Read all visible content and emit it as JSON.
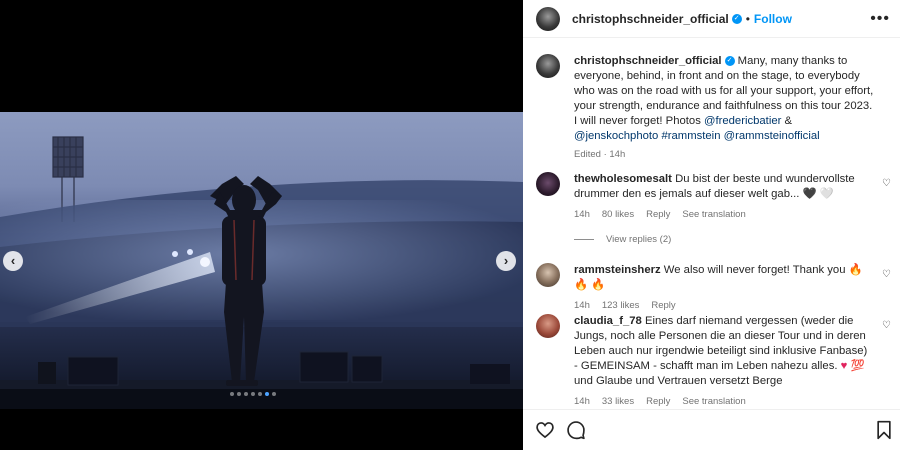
{
  "carousel": {
    "prev_icon": "chevron-left-icon",
    "next_icon": "chevron-right-icon",
    "slide_count": 7,
    "active_slide": 6
  },
  "header": {
    "username": "christophschneider_official",
    "verified": true,
    "separator": "•",
    "follow_label": "Follow",
    "more_icon": "more-horizontal-icon"
  },
  "caption": {
    "username": "christophschneider_official",
    "text": "Many, many thanks to everyone, behind, in front and on the stage, to everybody who was on the road with us for all your support, your effort, your strength, endurance and faithfulness on this tour 2023. I will never forget! Photos",
    "mention1": "@fredericbatier",
    "amp": "&",
    "mention2": "@jenskochphoto",
    "hashtag": "#rammstein",
    "mention3": "@rammsteinofficial",
    "meta": "Edited · 14h"
  },
  "comments": [
    {
      "username": "thewholesomesalt",
      "text": "Du bist der beste und wundervollste drummer den es jemals auf dieser welt gab...",
      "emoji": "🖤 🤍",
      "time": "14h",
      "likes": "80 likes",
      "reply": "Reply",
      "translate": "See translation"
    },
    {
      "username": "rammsteinsherz",
      "text": "We also will never forget! Thank you",
      "emoji": "🔥 🔥 🔥",
      "time": "14h",
      "likes": "123 likes",
      "reply": "Reply"
    },
    {
      "username": "claudia_f_78",
      "text": "Eines darf niemand vergessen (weder die Jungs, noch alle Personen die an dieser Tour und in deren Leben auch nur irgendwie beteiligt sind inklusive Fanbase) - GEMEINSAM - schafft man im Leben nahezu alles.",
      "emoji": "♥ 💯",
      "text2": "und Glaube und Vertrauen versetzt Berge",
      "time": "14h",
      "likes": "33 likes",
      "reply": "Reply",
      "translate": "See translation"
    }
  ],
  "view_replies": "View replies (2)",
  "icons": {
    "like": "heart-icon",
    "comment": "comment-icon",
    "save": "bookmark-icon"
  },
  "colors": {
    "accent": "#0095f6",
    "link": "#00376b",
    "muted": "#737373"
  }
}
